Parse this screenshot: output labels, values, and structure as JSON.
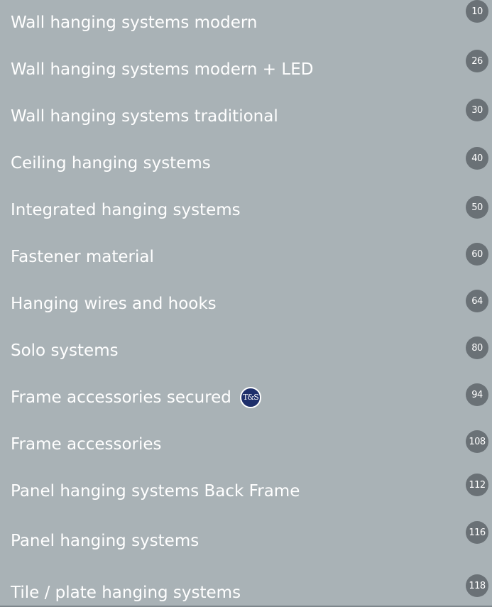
{
  "toc": {
    "items": [
      {
        "label": "Wall hanging systems modern",
        "page": "10"
      },
      {
        "label": "Wall hanging systems modern + LED",
        "page": "26"
      },
      {
        "label": "Wall hanging systems traditional",
        "page": "30"
      },
      {
        "label": "Ceiling hanging systems",
        "page": "40"
      },
      {
        "label": "Integrated hanging systems",
        "page": "50"
      },
      {
        "label": "Fastener material",
        "page": "60"
      },
      {
        "label": "Hanging wires and hooks",
        "page": "64"
      },
      {
        "label": "Solo systems",
        "page": "80"
      },
      {
        "label": "Frame accessories secured",
        "page": "94",
        "badge": "T&S"
      },
      {
        "label": "Frame accessories",
        "page": "108"
      },
      {
        "label": "Panel hanging systems Back Frame",
        "page": "112"
      },
      {
        "label": "Panel hanging systems",
        "page": "116"
      },
      {
        "label": "Tile / plate hanging systems",
        "page": "118"
      }
    ]
  },
  "colors": {
    "background": "#a9b2b6",
    "text": "#ffffff",
    "page_badge": "#6a7176",
    "ts_badge": "#1e2f6b"
  }
}
